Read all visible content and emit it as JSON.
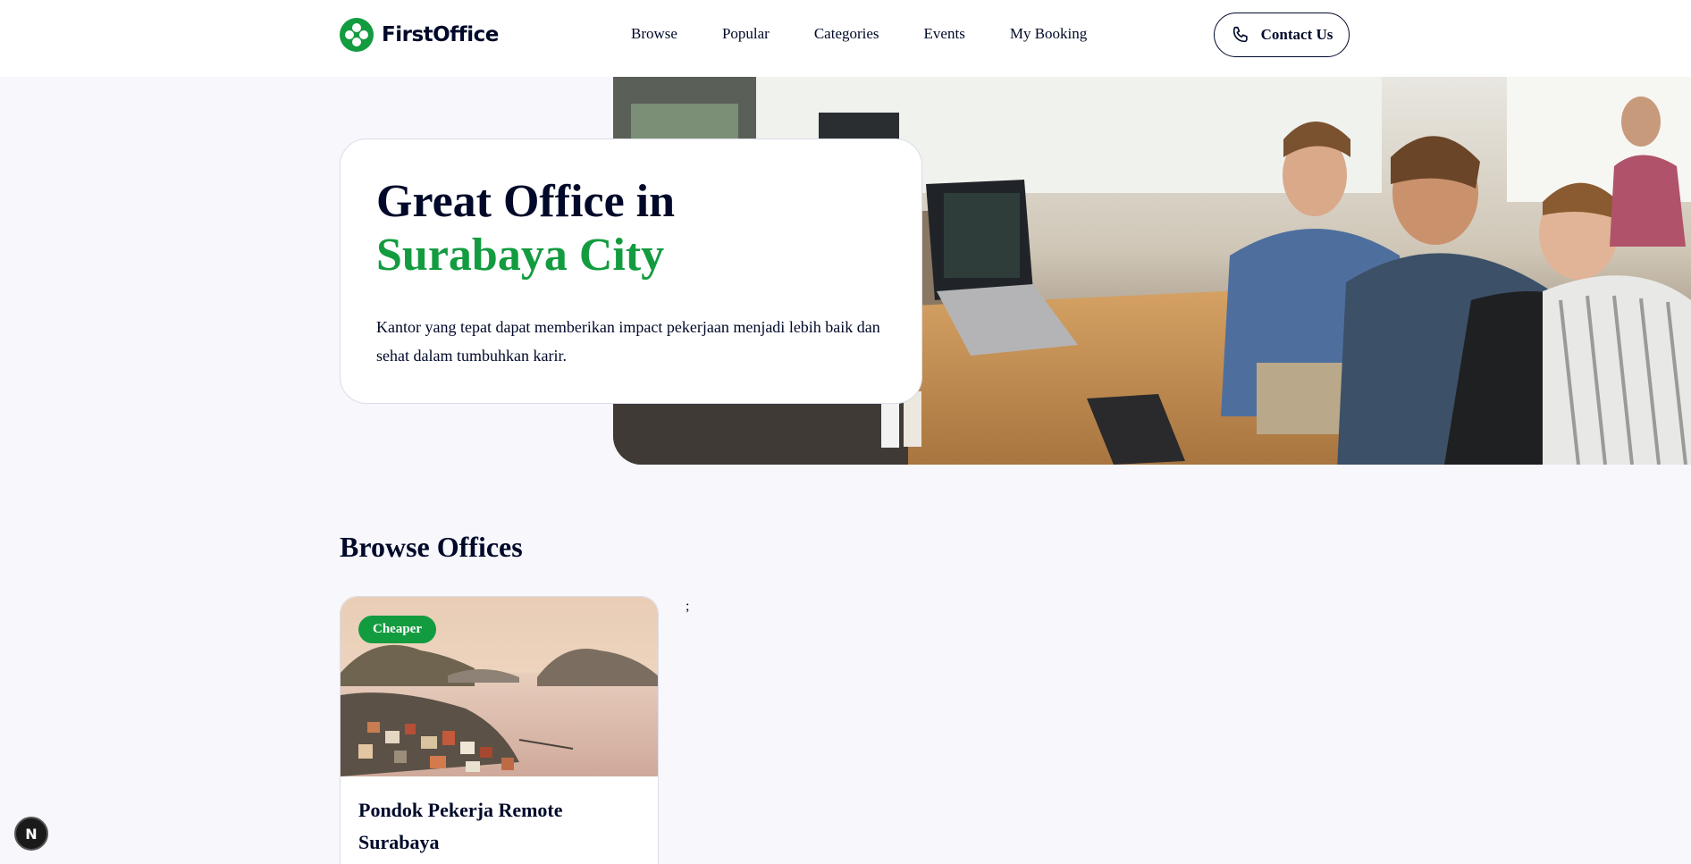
{
  "brand": {
    "name": "FirstOffice",
    "accent_color": "#139b3f",
    "dark_color": "#000929"
  },
  "nav": {
    "items": [
      {
        "label": "Browse"
      },
      {
        "label": "Popular"
      },
      {
        "label": "Categories"
      },
      {
        "label": "Events"
      },
      {
        "label": "My Booking"
      }
    ],
    "contact_label": "Contact Us",
    "contact_icon": "phone-icon"
  },
  "hero": {
    "title_line1": "Great Office in",
    "title_line2": "Surabaya City",
    "description": "Kantor yang tepat dapat memberikan impact pekerjaan menjadi lebih baik dan sehat dalam tumbuhkan karir.",
    "photo": "coworking-office-photo"
  },
  "browse": {
    "title": "Browse Offices",
    "offices": [
      {
        "name": "Pondok Pekerja Remote Surabaya",
        "badge": "Cheaper",
        "photo": "coastal-city-photo"
      }
    ],
    "stray_text": ";"
  },
  "dev_indicator": {
    "letter": "N"
  }
}
